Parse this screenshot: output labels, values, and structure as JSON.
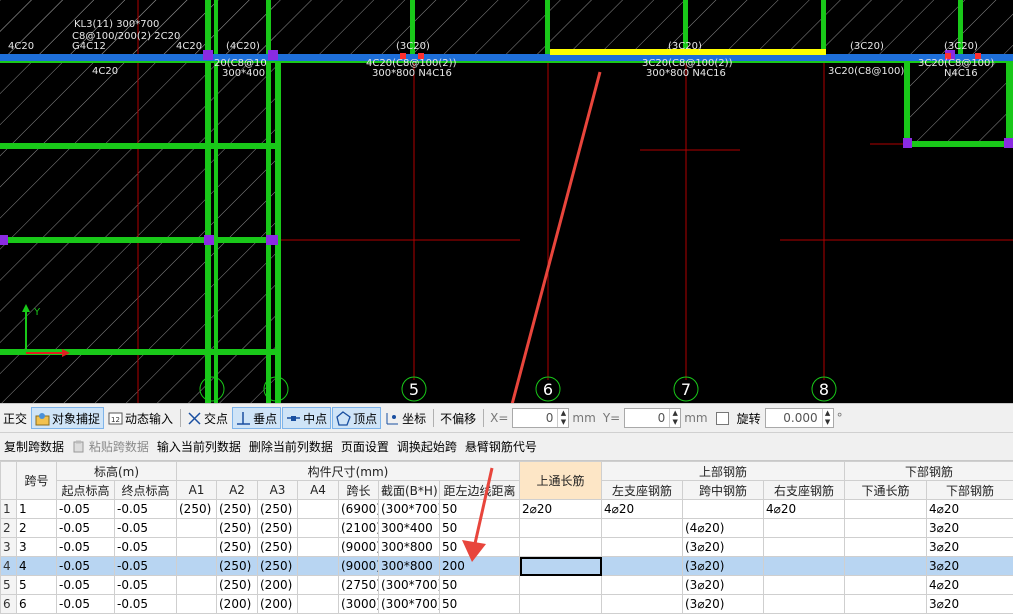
{
  "canvas": {
    "beam_labels": {
      "kl3_name": "KL3(11) 300*700",
      "kl3_stirrup": "C8@100/200(2) 2C20",
      "kl3_side": "G4C12",
      "left_top_a": "4C20",
      "left_top_b": "4C20",
      "left_top_c": "(4C20)",
      "left_bottom": "4C20",
      "span2_stirrup": "20(C8@10",
      "span2_size": "300*400",
      "span3_top": "(3C20)",
      "span3_stirrup": "4C20(C8@100(2))",
      "span3_size": "300*800 N4C16",
      "span4_top": "(3C20)",
      "span4_stirrup": "3C20(C8@100(2))",
      "span4_size": "300*800 N4C16",
      "right_top": "(3C20)",
      "right_stirrup": "3C20(C8@100)",
      "right_top2": "(3C20)",
      "right_stirrup2": "3C20(C8@100)",
      "right_size": "N4C16"
    },
    "axis_numbers": [
      "5",
      "6",
      "7",
      "8"
    ],
    "ucs_y": "Y",
    "colors": {
      "beam": "#1e6fd9",
      "column_band": "#19c819",
      "selected_span": "#ffff00",
      "grid_line": "#c00000",
      "hatch": "#8c8c8c",
      "arrow": "#e8453c"
    }
  },
  "snapbar": {
    "ortho": "正交",
    "object_snap": "对象捕捉",
    "dynamic_input": "动态输入",
    "intersection": "交点",
    "perpendicular": "垂点",
    "midpoint": "中点",
    "vertex": "顶点",
    "coordinate": "坐标",
    "no_offset": "不偏移",
    "x_label": "X=",
    "x_value": "0",
    "x_unit": "mm",
    "y_label": "Y=",
    "y_value": "0",
    "y_unit": "mm",
    "rotate_label": "旋转",
    "rotate_value": "0.000",
    "rotate_unit": "°"
  },
  "tabletools": {
    "copy_span": "复制跨数据",
    "paste_span": "粘贴跨数据",
    "input_column": "输入当前列数据",
    "delete_column": "删除当前列数据",
    "page_setup": "页面设置",
    "swap_start": "调换起始跨",
    "cantilever_code": "悬臂钢筋代号"
  },
  "grid": {
    "group_headers": {
      "span_no": "跨号",
      "elevation": "标高(m)",
      "dimensions": "构件尺寸(mm)",
      "top_through": "上通长筋",
      "top_rebar": "上部钢筋",
      "bottom_rebar": "下部钢筋"
    },
    "columns": [
      "起点标高",
      "终点标高",
      "A1",
      "A2",
      "A3",
      "A4",
      "跨长",
      "截面(B*H)",
      "距左边线距离",
      "左支座钢筋",
      "跨中钢筋",
      "右支座钢筋",
      "下通长筋",
      "下部钢筋"
    ],
    "rows": [
      {
        "rh": "1",
        "no": "1",
        "start": "-0.05",
        "end": "-0.05",
        "a1": "(250)",
        "a2": "(250)",
        "a3": "(250)",
        "a4": "",
        "len": "(6900)",
        "sec": "(300*700)",
        "dist": "50",
        "top": "2⌀20",
        "left": "4⌀20",
        "mid": "",
        "right": "4⌀20",
        "btm_thru": "",
        "btm": "4⌀20"
      },
      {
        "rh": "2",
        "no": "2",
        "start": "-0.05",
        "end": "-0.05",
        "a1": "",
        "a2": "(250)",
        "a3": "(250)",
        "a4": "",
        "len": "(2100)",
        "sec": "300*400",
        "dist": "50",
        "top": "",
        "left": "",
        "mid": "(4⌀20)",
        "right": "",
        "btm_thru": "",
        "btm": "3⌀20"
      },
      {
        "rh": "3",
        "no": "3",
        "start": "-0.05",
        "end": "-0.05",
        "a1": "",
        "a2": "(250)",
        "a3": "(250)",
        "a4": "",
        "len": "(9000)",
        "sec": "300*800",
        "dist": "50",
        "top": "",
        "left": "",
        "mid": "(3⌀20)",
        "right": "",
        "btm_thru": "",
        "btm": "3⌀20"
      },
      {
        "rh": "4",
        "no": "4",
        "start": "-0.05",
        "end": "-0.05",
        "a1": "",
        "a2": "(250)",
        "a3": "(250)",
        "a4": "",
        "len": "(9000)",
        "sec": "300*800",
        "dist": "200",
        "top": "",
        "left": "",
        "mid": "(3⌀20)",
        "right": "",
        "btm_thru": "",
        "btm": "3⌀20"
      },
      {
        "rh": "5",
        "no": "5",
        "start": "-0.05",
        "end": "-0.05",
        "a1": "",
        "a2": "(250)",
        "a3": "(200)",
        "a4": "",
        "len": "(2750)",
        "sec": "(300*700)",
        "dist": "50",
        "top": "",
        "left": "",
        "mid": "(3⌀20)",
        "right": "",
        "btm_thru": "",
        "btm": "4⌀20"
      },
      {
        "rh": "6",
        "no": "6",
        "start": "-0.05",
        "end": "-0.05",
        "a1": "",
        "a2": "(200)",
        "a3": "(200)",
        "a4": "",
        "len": "(3000)",
        "sec": "(300*700)",
        "dist": "50",
        "top": "",
        "left": "",
        "mid": "(3⌀20)",
        "right": "",
        "btm_thru": "",
        "btm": "3⌀20"
      }
    ]
  }
}
